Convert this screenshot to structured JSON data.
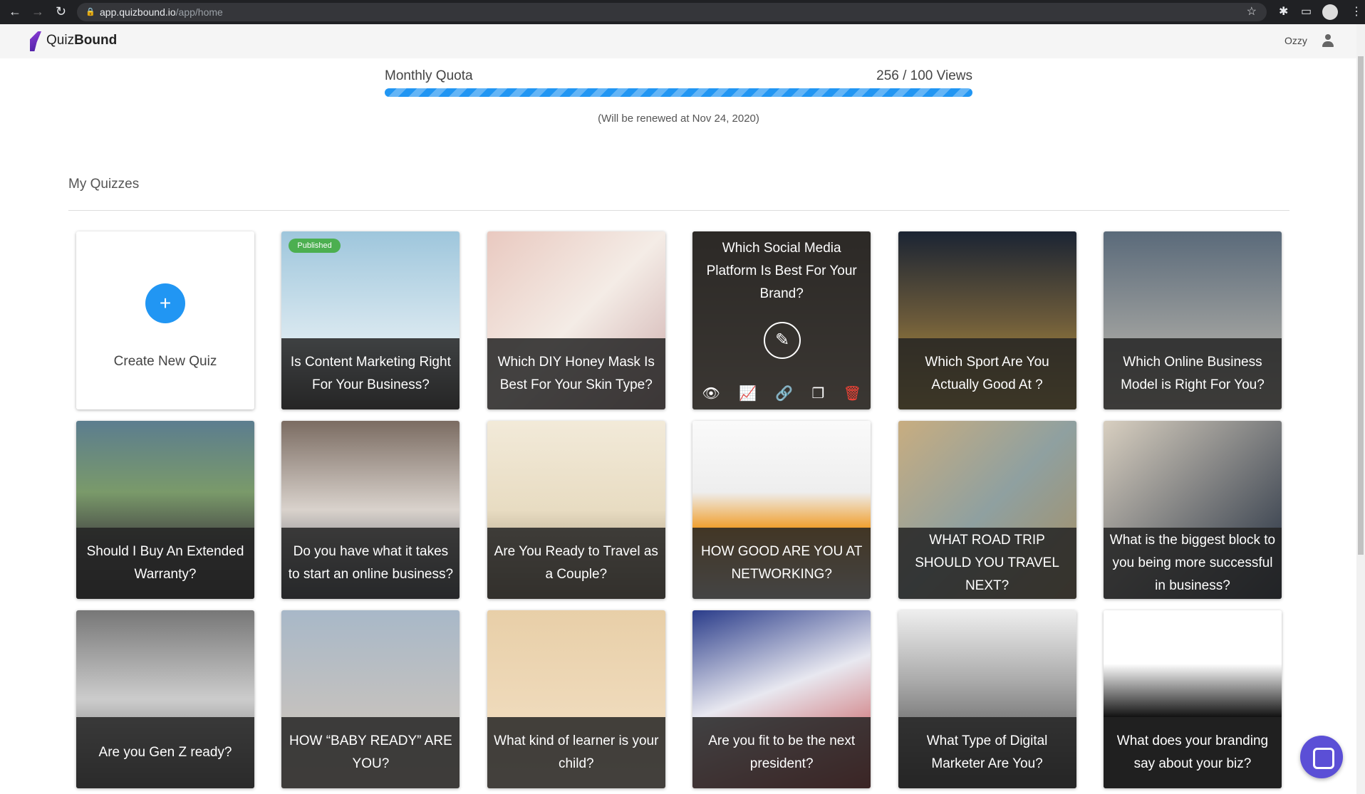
{
  "browser": {
    "url_host": "app.quizbound.io",
    "url_path": "/app/home"
  },
  "app": {
    "logo_light": "Quiz",
    "logo_bold": "Bound",
    "user": "Ozzy"
  },
  "quota": {
    "label": "Monthly Quota",
    "value_text": "256 / 100 Views",
    "used": 256,
    "limit": 100,
    "fill_percent": 100,
    "renew_text": "(Will be renewed at Nov 24, 2020)"
  },
  "section_title": "My Quizzes",
  "create_label": "Create New Quiz",
  "badge_published": "Published",
  "quizzes": [
    {
      "title": "Is Content Marketing Right For Your Business?"
    },
    {
      "title": "Which DIY Honey Mask Is Best For Your Skin Type?"
    },
    {
      "title": "Which Social Media Platform Is Best For Your Brand?"
    },
    {
      "title": "Which Sport Are You Actually Good At ?"
    },
    {
      "title": "Which Online Business Model is Right For You?"
    },
    {
      "title": "Should I Buy An Extended Warranty?"
    },
    {
      "title": "Do you have what it takes to start an online business?"
    },
    {
      "title": "Are You Ready to Travel as a Couple?"
    },
    {
      "title": "HOW GOOD ARE YOU AT NETWORKING?"
    },
    {
      "title": "WHAT ROAD TRIP SHOULD YOU TRAVEL NEXT?"
    },
    {
      "title": "What is the biggest block to you being more successful in business?"
    },
    {
      "title": "Are you Gen Z ready?"
    },
    {
      "title": "HOW “BABY READY” ARE YOU?"
    },
    {
      "title": "What kind of learner is your child?"
    },
    {
      "title": "Are you fit to be the next president?"
    },
    {
      "title": "What Type of Digital Marketer Are You?"
    },
    {
      "title": "What does your branding say about your biz?"
    }
  ],
  "colors": {
    "accent": "#2196f3",
    "published": "#4caf50",
    "delete": "#f44336"
  }
}
